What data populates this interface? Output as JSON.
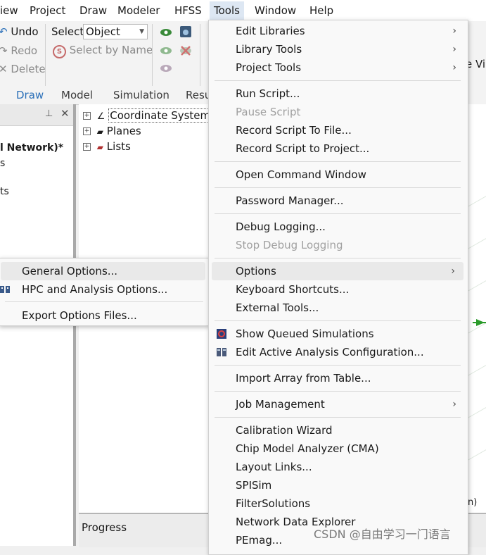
{
  "menubar": {
    "items": [
      "iew",
      "Project",
      "Draw",
      "Modeler",
      "HFSS",
      "Tools",
      "Window",
      "Help"
    ]
  },
  "ribbon": {
    "undo": "Undo",
    "redo": "Redo",
    "delete": "Delete",
    "select_label": "Select:",
    "select_value": "Object",
    "select_by_name": "Select by Name",
    "right_e": "e",
    "right_vi": "Vi"
  },
  "tabs": [
    "Draw",
    "Model",
    "Simulation",
    "Resu"
  ],
  "left_panel": {
    "title": "l Network)*",
    "line2": "s",
    "line3": "ts"
  },
  "tree": {
    "items": [
      "Coordinate System",
      "Planes",
      "Lists"
    ]
  },
  "progress": {
    "label": "Progress"
  },
  "viewport": {
    "trail": "n)"
  },
  "tools_menu": {
    "items": [
      {
        "label": "Edit Libraries",
        "submenu": true
      },
      {
        "label": "Library Tools",
        "submenu": true
      },
      {
        "label": "Project Tools",
        "submenu": true
      },
      {
        "label": "Run Script..."
      },
      {
        "label": "Pause Script",
        "disabled": true
      },
      {
        "label": "Record Script To File..."
      },
      {
        "label": "Record Script to Project..."
      },
      {
        "label": "Open Command Window"
      },
      {
        "label": "Password Manager..."
      },
      {
        "label": "Debug Logging..."
      },
      {
        "label": "Stop Debug Logging",
        "disabled": true
      },
      {
        "label": "Options",
        "submenu": true,
        "highlighted": true
      },
      {
        "label": "Keyboard Shortcuts..."
      },
      {
        "label": "External Tools..."
      },
      {
        "label": "Show Queued Simulations",
        "icon": "queue-icon"
      },
      {
        "label": "Edit Active Analysis Configuration...",
        "icon": "analysis-config-icon"
      },
      {
        "label": "Import Array from Table..."
      },
      {
        "label": "Job Management",
        "submenu": true
      },
      {
        "label": "Calibration Wizard"
      },
      {
        "label": "Chip Model Analyzer (CMA)"
      },
      {
        "label": "Layout Links..."
      },
      {
        "label": "SPISim"
      },
      {
        "label": "FilterSolutions"
      },
      {
        "label": "Network Data Explorer"
      },
      {
        "label": "PEmag..."
      }
    ]
  },
  "options_menu": {
    "items": [
      {
        "label": "General Options...",
        "highlighted": true
      },
      {
        "label": "HPC and Analysis Options...",
        "icon": "hpc-icon"
      },
      {
        "label": "Export Options Files..."
      }
    ]
  },
  "watermark": "CSDN @自由学习一门语言",
  "colors": {
    "accent": "#2a6fb8",
    "highlight": "#e9e9e9",
    "menu_bg": "#f9f9f9"
  }
}
